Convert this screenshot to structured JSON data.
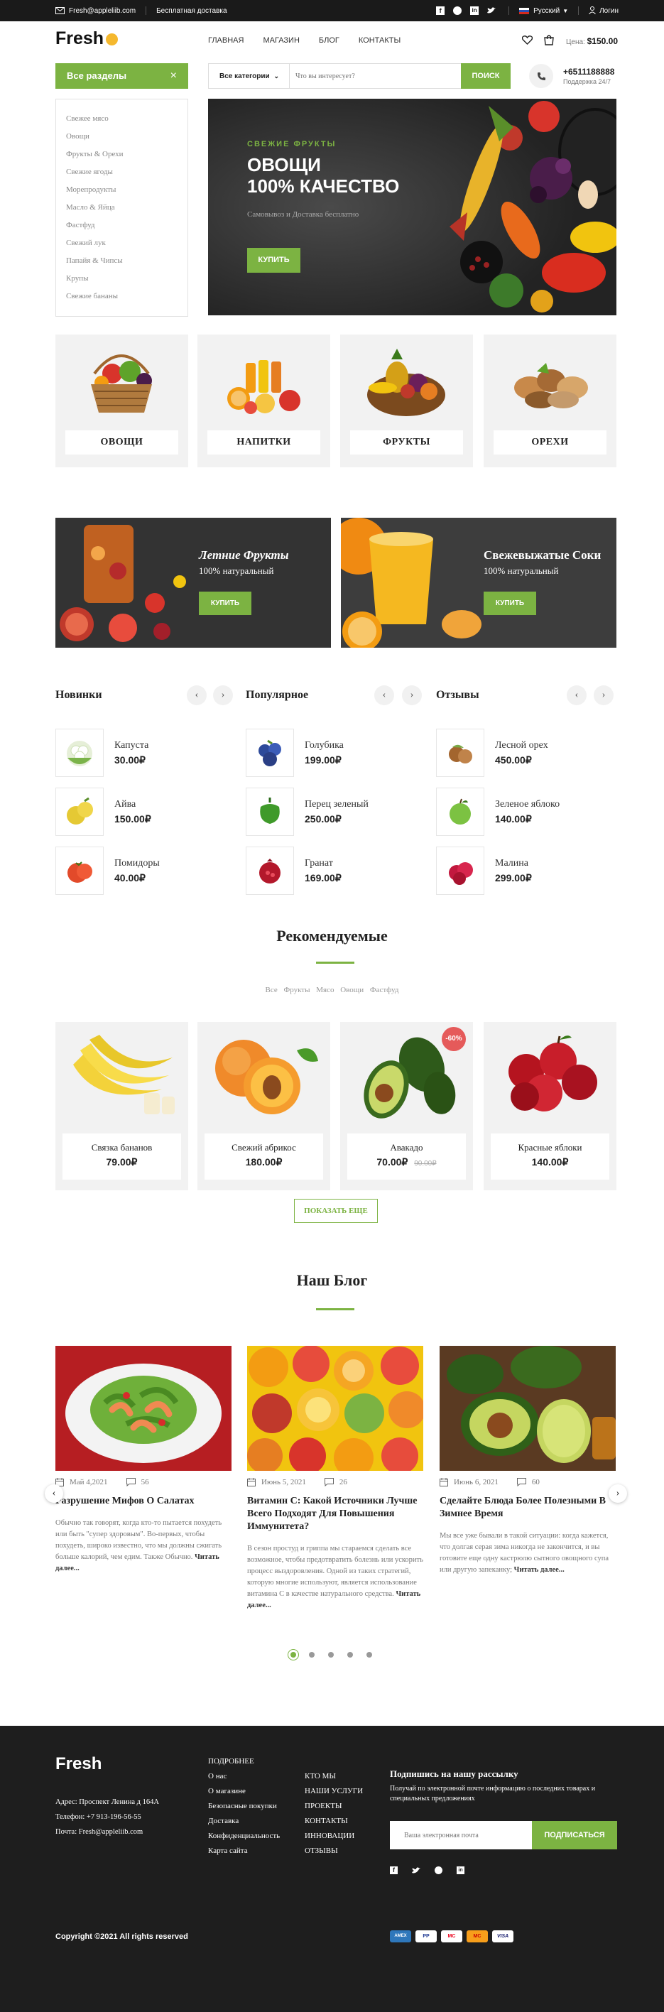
{
  "topbar": {
    "email": "Fresh@appleliib.com",
    "delivery": "Бесплатная доставка",
    "language": "Русский",
    "login": "Логин"
  },
  "header": {
    "logo": "Fresh",
    "nav": [
      "ГЛАВНАЯ",
      "МАГАЗИН",
      "БЛОГ",
      "КОНТАКТЫ"
    ],
    "cart_label": "Цена:",
    "cart_total": "$150.00"
  },
  "search": {
    "category": "Все категории",
    "placeholder": "Что вы интересует?",
    "button": "ПОИСК"
  },
  "support": {
    "phone": "+6511188888",
    "hours": "Поддержка 24/7"
  },
  "sidebar": {
    "title": "Все разделы",
    "items": [
      "Свежее мясо",
      "Овощи",
      "Фрукты & Орехи",
      "Свежие ягоды",
      "Морепродукты",
      "Масло & Яйца",
      "Фастфуд",
      "Свежий лук",
      "Папайя & Чипсы",
      "Крупы",
      "Свежие бананы"
    ]
  },
  "hero": {
    "eyebrow": "СВЕЖИЕ ФРУКТЫ",
    "title1": "ОВОЩИ",
    "title2": "100% КАЧЕСТВО",
    "subtitle": "Самовывоз и Доставка бесплатно",
    "button": "КУПИТЬ"
  },
  "categories": [
    "ОВОЩИ",
    "НАПИТКИ",
    "ФРУКТЫ",
    "ОРЕХИ"
  ],
  "banners": [
    {
      "title": "Летние Фрукты",
      "subtitle": "100% натуральный",
      "button": "КУПИТЬ"
    },
    {
      "title": "Свежевыжатые Соки",
      "subtitle": "100% натуральный",
      "button": "КУПИТЬ"
    }
  ],
  "lists": [
    {
      "title": "Новинки",
      "items": [
        {
          "name": "Капуста",
          "price": "30.00₽"
        },
        {
          "name": "Айва",
          "price": "150.00₽"
        },
        {
          "name": "Помидоры",
          "price": "40.00₽"
        }
      ]
    },
    {
      "title": "Популярное",
      "items": [
        {
          "name": "Голубика",
          "price": "199.00₽"
        },
        {
          "name": "Перец зеленый",
          "price": "250.00₽"
        },
        {
          "name": "Гранат",
          "price": "169.00₽"
        }
      ]
    },
    {
      "title": "Отзывы",
      "items": [
        {
          "name": "Лесной орех",
          "price": "450.00₽"
        },
        {
          "name": "Зеленое яблоко",
          "price": "140.00₽"
        },
        {
          "name": "Малина",
          "price": "299.00₽"
        }
      ]
    }
  ],
  "featured": {
    "title": "Рекомендуемые",
    "filters": [
      "Все",
      "Фрукты",
      "Мясо",
      "Овощи",
      "Фастфуд"
    ],
    "items": [
      {
        "name": "Связка бананов",
        "price": "79.00₽",
        "old": ""
      },
      {
        "name": "Свежий абрикос",
        "price": "180.00₽",
        "old": ""
      },
      {
        "name": "Авакадо",
        "price": "70.00₽",
        "old": "90.00₽",
        "badge": "-60%"
      },
      {
        "name": "Красные яблоки",
        "price": "140.00₽",
        "old": ""
      }
    ],
    "more": "ПОКАЗАТЬ ЕЩЕ"
  },
  "blog": {
    "title": "Наш Блог",
    "posts": [
      {
        "date": "Май 4,2021",
        "comments": "56",
        "title": "Разрушение Мифов О Салатах",
        "text": "Обычно так говорят, когда кто-то пытается похудеть или быть \"супер здоровым\". Во-первых, чтобы похудеть, широко известно, что мы должны сжигать больше калорий, чем едим. Также Обычно.",
        "more": "Читать далее..."
      },
      {
        "date": "Июнь 5, 2021",
        "comments": "26",
        "title": "Витамин С: Какой Источники Лучше Всего Подходят Для Повышения Иммунитета?",
        "text": "В сезон простуд и гриппа мы стараемся сделать все возможное, чтобы предотвратить болезнь или ускорить процесс выздоровления. Одной из таких стратегий, которую многие используют, является использование витамина С в качестве натурального средства.",
        "more": "Читать далее..."
      },
      {
        "date": "Июнь 6, 2021",
        "comments": "60",
        "title": "Сделайте Блюда Более Полезными В Зимнее Время",
        "text": "Мы все уже бывали в такой ситуации: когда кажется, что долгая серая зима никогда не закончится, и вы готовите еще одну кастрюлю сытного овощного супа или другую запеканку;",
        "more": "Читать далее..."
      }
    ]
  },
  "footer": {
    "logo": "Fresh",
    "address": "Адрес: Проспект Ленина д 164А",
    "phone": "Телефон: +7 913-196-56-55",
    "email": "Почта: Fresh@appleliib.com",
    "col1_title": "ПОДРОБНЕЕ",
    "col1": [
      "О нас",
      "О магазине",
      "Безопасные покупки",
      "Доставка",
      "Конфиденциальность",
      "Карта сайта"
    ],
    "col2": [
      "КТО МЫ",
      "НАШИ УСЛУГИ",
      "ПРОЕКТЫ",
      "КОНТАКТЫ",
      "ИННОВАЦИИ",
      "ОТЗЫВЫ"
    ],
    "newsletter_title": "Подпишись на нашу рассылку",
    "newsletter_text": "Получай по электронной почте информацию о последних товарах и специальных предложениях",
    "newsletter_placeholder": "Ваша электронная почта",
    "newsletter_button": "ПОДПИСАТЬСЯ",
    "copyright": "Copyright ©2021 All rights reserved",
    "payments": [
      "AMEX",
      "PP",
      "MC",
      "MC",
      "VISA"
    ]
  },
  "colors": {
    "accent": "#7cb342",
    "dark": "#1e1e1e"
  }
}
